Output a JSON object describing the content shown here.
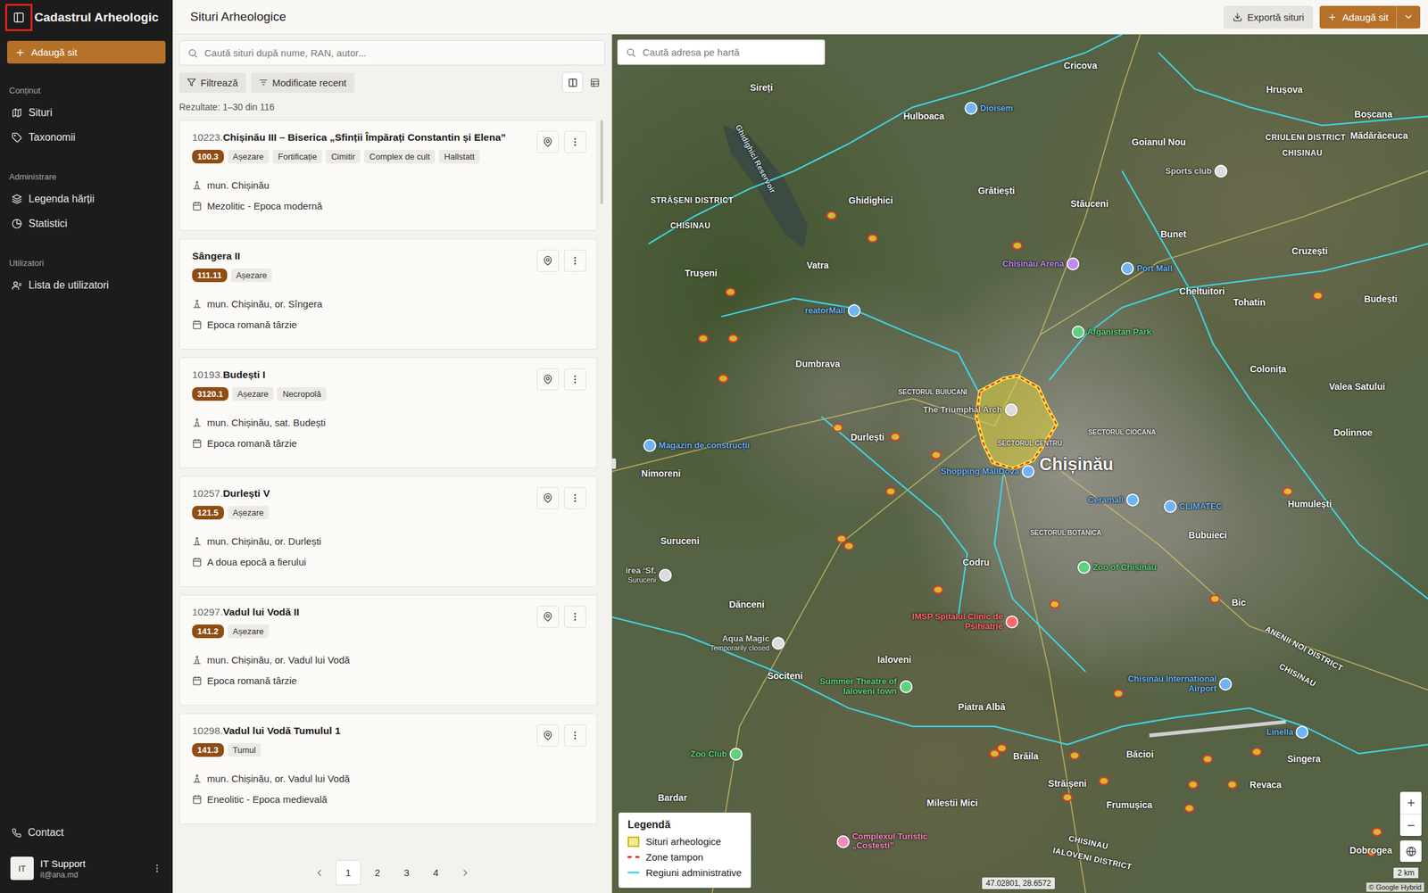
{
  "sidebar": {
    "toggle": {
      "highlighted": true
    },
    "title": "Cadastrul Arheologic",
    "add_button": "Adaugă sit",
    "sections": [
      {
        "label": "Conținut",
        "items": [
          {
            "label": "Situri",
            "selected": false
          },
          {
            "label": "Taxonomii",
            "selected": false
          }
        ]
      },
      {
        "label": "Administrare",
        "items": [
          {
            "label": "Legenda hărții",
            "selected": false
          },
          {
            "label": "Statistici",
            "selected": false
          }
        ]
      },
      {
        "label": "Utilizatori",
        "items": [
          {
            "label": "Lista de utilizatori",
            "selected": false
          }
        ]
      }
    ],
    "contact": "Contact",
    "user": {
      "initials": "IT",
      "name": "IT Support",
      "email": "it@ana.md"
    }
  },
  "header": {
    "title": "Situri Arheologice",
    "export_button": "Exportă situri",
    "add_button": "Adaugă sit"
  },
  "list": {
    "search": {
      "placeholder": "Caută situri după nume, RAN, autor..."
    },
    "filter_button": "Filtrează",
    "sort_button": "Modificate recent",
    "views": [
      {
        "kind": "split",
        "selected": true
      },
      {
        "kind": "table",
        "selected": false
      }
    ],
    "results": "Rezultate: 1–30 din 116",
    "sites": [
      {
        "number": "10223.",
        "name": "Chișinău III – Biserica „Sfinții Împărați Constantin și Elena”",
        "code": "100.3",
        "tags": [
          "Așezare",
          "Fortificație",
          "Cimitir",
          "Complex de cult",
          "Hallstatt"
        ],
        "location": "mun. Chișinău",
        "period": "Mezolitic - Epoca modernă"
      },
      {
        "name": "Sângera II",
        "code": "111.11",
        "tags": [
          "Așezare"
        ],
        "location": "mun. Chișinău, or. Sîngera",
        "period": "Epoca romană târzie"
      },
      {
        "number": "10193.",
        "name": "Budești I",
        "code": "3120.1",
        "tags": [
          "Așezare",
          "Necropolă"
        ],
        "location": "mun. Chișinău, sat. Budești",
        "period": "Epoca romană târzie"
      },
      {
        "number": "10257.",
        "name": "Durlești V",
        "code": "121.5",
        "tags": [
          "Așezare"
        ],
        "location": "mun. Chișinău, or. Durlești",
        "period": "A doua epocă a fierului"
      },
      {
        "number": "10297.",
        "name": "Vadul lui Vodă II",
        "code": "141.2",
        "tags": [
          "Așezare"
        ],
        "location": "mun. Chișinău, or. Vadul lui Vodă",
        "period": "Epoca romană târzie"
      },
      {
        "number": "10298.",
        "name": "Vadul lui Vodă Tumulul 1",
        "code": "141.3",
        "tags": [
          "Tumul"
        ],
        "location": "mun. Chișinău, or. Vadul lui Vodă",
        "period": "Eneolitic - Epoca medievală"
      }
    ],
    "pagination": [
      {
        "label": "1",
        "selected": true
      },
      {
        "label": "2",
        "selected": false
      },
      {
        "label": "3",
        "selected": false
      },
      {
        "label": "4",
        "selected": false
      }
    ]
  },
  "map": {
    "search": {
      "placeholder": "Caută adresa pe hartă"
    },
    "labels": [
      {
        "text": "Chișinău",
        "kind": "city"
      },
      {
        "text": "Sireți",
        "kind": "place"
      },
      {
        "text": "Cricova",
        "kind": "place"
      },
      {
        "text": "Hrușova",
        "kind": "place"
      },
      {
        "text": "Hulboaca",
        "kind": "place"
      },
      {
        "text": "Goianul Nou",
        "kind": "place"
      },
      {
        "text": "Boșcana",
        "kind": "place"
      },
      {
        "text": "Mădărăceuca",
        "kind": "place"
      },
      {
        "text": "Grătiești",
        "kind": "place"
      },
      {
        "text": "Stăuceni",
        "kind": "place"
      },
      {
        "text": "Ghidighici",
        "kind": "place"
      },
      {
        "text": "Bunet",
        "kind": "place"
      },
      {
        "text": "Cruzești",
        "kind": "place"
      },
      {
        "text": "Trușeni",
        "kind": "place"
      },
      {
        "text": "Vatra",
        "kind": "place"
      },
      {
        "text": "Cheltuitori",
        "kind": "place"
      },
      {
        "text": "Tohatin",
        "kind": "place"
      },
      {
        "text": "Budești",
        "kind": "place"
      },
      {
        "text": "Colonița",
        "kind": "place"
      },
      {
        "text": "Valea Satului",
        "kind": "place"
      },
      {
        "text": "Dolinnoe",
        "kind": "place"
      },
      {
        "text": "Dumbrava",
        "kind": "place"
      },
      {
        "text": "Durlești",
        "kind": "place"
      },
      {
        "text": "Nimoreni",
        "kind": "place"
      },
      {
        "text": "Humulești",
        "kind": "place"
      },
      {
        "text": "Bubuieci",
        "kind": "place"
      },
      {
        "text": "Suruceni",
        "kind": "place"
      },
      {
        "text": "Codru",
        "kind": "place"
      },
      {
        "text": "Dănceni",
        "kind": "place"
      },
      {
        "text": "Bic",
        "kind": "place"
      },
      {
        "text": "Ialoveni",
        "kind": "place"
      },
      {
        "text": "Sociteni",
        "kind": "place"
      },
      {
        "text": "Piatra Albă",
        "kind": "place"
      },
      {
        "text": "Bardar",
        "kind": "place"
      },
      {
        "text": "Milestii Mici",
        "kind": "place"
      },
      {
        "text": "Brăila",
        "kind": "place"
      },
      {
        "text": "Băcioi",
        "kind": "place"
      },
      {
        "text": "Frumușica",
        "kind": "place"
      },
      {
        "text": "Singera",
        "kind": "place"
      },
      {
        "text": "Revaca",
        "kind": "place"
      },
      {
        "text": "Străișeni",
        "kind": "place"
      },
      {
        "text": "Dobrogea",
        "kind": "place"
      },
      {
        "text": "STRĂȘENI DISTRICT",
        "kind": "district"
      },
      {
        "text": "CHISINAU",
        "kind": "district"
      },
      {
        "text": "CRIULENI DISTRICT",
        "kind": "district"
      },
      {
        "text": "CHISINAU",
        "kind": "district"
      },
      {
        "text": "ANENII NOI DISTRICT",
        "kind": "district"
      },
      {
        "text": "CHISINAU",
        "kind": "district"
      },
      {
        "text": "CHISINAU",
        "kind": "district"
      },
      {
        "text": "IALOVENI DISTRICT",
        "kind": "district"
      },
      {
        "text": "SECTORUL BUIUCANI",
        "kind": "sector"
      },
      {
        "text": "SECTORUL CENTRU",
        "kind": "sector"
      },
      {
        "text": "SECTORUL CIOCANA",
        "kind": "sector"
      },
      {
        "text": "SECTORUL BOTANICA",
        "kind": "sector"
      },
      {
        "text": "Ghidighici Reservoir",
        "kind": "water"
      }
    ],
    "pois": [
      {
        "label": "Dioisem",
        "color": "#6fb4f5"
      },
      {
        "label": "Sports club",
        "color": "#dcdcdc"
      },
      {
        "label": "Chișinău Arena",
        "color": "#c08af0"
      },
      {
        "label": "Port Mall",
        "color": "#6fb4f5"
      },
      {
        "label": "Afganistan Park",
        "color": "#5fd17a"
      },
      {
        "label": "reatorMall",
        "color": "#6fb4f5"
      },
      {
        "label": "Magazin de construcții",
        "color": "#6fb4f5"
      },
      {
        "label": "The Triumphal Arch",
        "color": "#dcdcdc"
      },
      {
        "label": "Shopping MallDova",
        "color": "#6fb4f5"
      },
      {
        "label": "Ceramall",
        "color": "#6fb4f5"
      },
      {
        "label": "CLIMATEC",
        "color": "#6fb4f5"
      },
      {
        "label": "Zoo of Chișinău",
        "color": "#5fd17a"
      },
      {
        "label": "IMSP Spitalul Clinic de Psihiatrie",
        "color": "#ff6b6b"
      },
      {
        "label": "Aqua Magic",
        "sub": "Temporarily closed",
        "color": "#dcdcdc"
      },
      {
        "label": "irea ‘Sf.",
        "sub": "Suruceni",
        "color": "#dcdcdc"
      },
      {
        "label": "Summer Theatre of Ialoveni town",
        "color": "#5fd17a"
      },
      {
        "label": "Chișinău International Airport",
        "color": "#6fb4f5"
      },
      {
        "label": "Linella",
        "color": "#6fb4f5"
      },
      {
        "label": "Zoo Club",
        "color": "#5fd17a"
      },
      {
        "label": "Complexul Turistic „Costești”",
        "color": "#f28cc0"
      }
    ],
    "legend": {
      "title": "Legendă",
      "items": [
        {
          "label": "Situri arheologice",
          "kind": "fill"
        },
        {
          "label": "Zone tampon",
          "kind": "dashed"
        },
        {
          "label": "Regiuni administrative",
          "kind": "line"
        }
      ]
    },
    "coordinates": "47.02801, 28.6572",
    "scale": "2 km",
    "attribution": "© Google Hybrid"
  }
}
